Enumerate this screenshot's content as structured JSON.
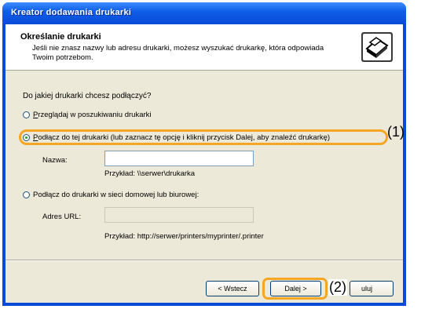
{
  "window": {
    "title": "Kreator dodawania drukarki"
  },
  "header": {
    "title": "Określanie drukarki",
    "subtitle": "Jeśli nie znasz nazwy lub adresu drukarki, możesz wyszukać drukarkę, która odpowiada Twoim potrzebom."
  },
  "main": {
    "question": "Do jakiej drukarki chcesz podłączyć?",
    "options": [
      {
        "label_prefix": "P",
        "label_rest": "rzeglądaj w poszukiwaniu drukarki",
        "checked": false
      },
      {
        "label_prefix": "P",
        "label_rest": "odłącz do tej drukarki (lub zaznacz tę opcję i kliknij przycisk Dalej, aby znaleźć drukarkę)",
        "checked": true
      },
      {
        "label_prefix": "",
        "label_rest": "Podłącz do drukarki w sieci domowej lub biurowej:",
        "checked": false
      }
    ],
    "name_label": "Nazwa:",
    "name_value": "",
    "name_example": "Przykład: \\\\serwer\\drukarka",
    "url_label": "Adres URL:",
    "url_value": "",
    "url_example": "Przykład: http://serwer/printers/myprinter/.printer"
  },
  "footer": {
    "back_label": "< Wstecz",
    "next_label": "Dalej >",
    "cancel_label": "Anuluj",
    "cancel_visible_part": "uluj"
  },
  "callouts": {
    "first": "(1)",
    "second": "(2)"
  },
  "colors": {
    "title_bar": "#0a4ad8",
    "highlight": "#f5a623",
    "dialog_bg": "#ece9d8"
  }
}
